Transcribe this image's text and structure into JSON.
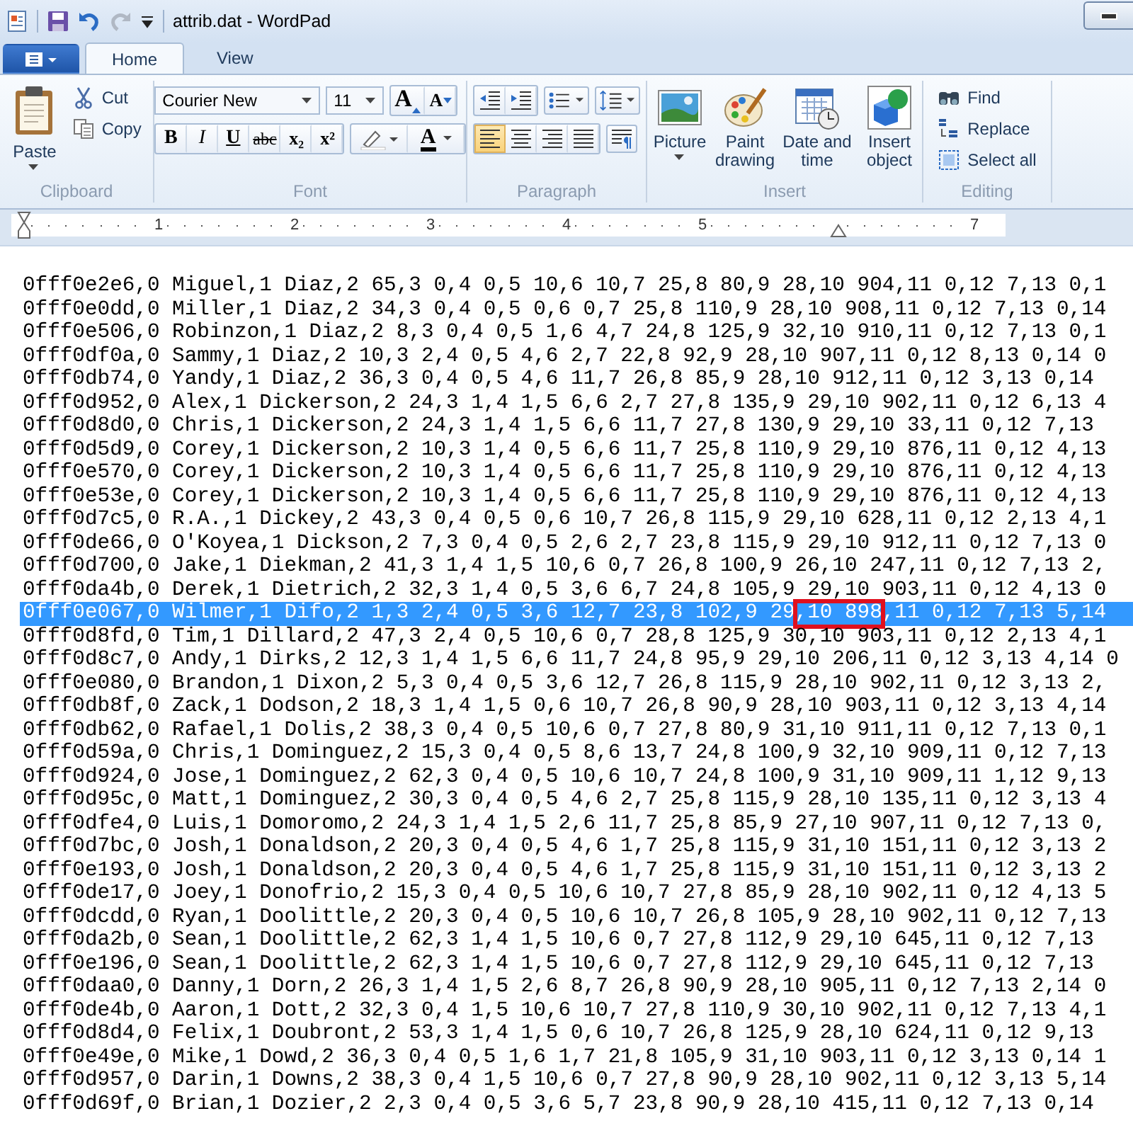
{
  "window": {
    "title": "attrib.dat - WordPad"
  },
  "tabs": [
    {
      "label": "Home",
      "selected": true
    },
    {
      "label": "View",
      "selected": false
    }
  ],
  "ribbon": {
    "clipboard": {
      "label": "Clipboard",
      "paste": "Paste",
      "cut": "Cut",
      "copy": "Copy"
    },
    "font": {
      "label": "Font",
      "family": "Courier New",
      "size": "11",
      "grow": "A",
      "shrink": "A",
      "text_color_label": "A",
      "format_buttons": [
        {
          "kind": "bold",
          "label": "B"
        },
        {
          "kind": "italic",
          "label": "I"
        },
        {
          "kind": "underline",
          "label": "U"
        },
        {
          "kind": "strike",
          "label": "abc"
        },
        {
          "kind": "sub",
          "label": "x₂"
        },
        {
          "kind": "sup",
          "label": "x²"
        }
      ]
    },
    "paragraph": {
      "label": "Paragraph",
      "alignments": [
        {
          "kind": "left",
          "selected": true
        },
        {
          "kind": "center",
          "selected": false
        },
        {
          "kind": "right",
          "selected": false
        },
        {
          "kind": "justify",
          "selected": false
        }
      ]
    },
    "insert": {
      "label": "Insert",
      "items": [
        {
          "kind": "picture",
          "label": "Picture",
          "dropdown": true
        },
        {
          "kind": "paint",
          "label": "Paint drawing",
          "dropdown": false
        },
        {
          "kind": "datetime",
          "label": "Date and time",
          "dropdown": false
        },
        {
          "kind": "object",
          "label": "Insert object",
          "dropdown": false
        }
      ]
    },
    "editing": {
      "label": "Editing",
      "items": [
        {
          "kind": "find",
          "label": "Find"
        },
        {
          "kind": "replace",
          "label": "Replace"
        },
        {
          "kind": "select",
          "label": "Select all"
        }
      ]
    }
  },
  "ruler": {
    "items": [
      {
        "kind": "number",
        "label": "1"
      },
      {
        "kind": "number",
        "label": "2"
      },
      {
        "kind": "number",
        "label": "3"
      },
      {
        "kind": "number",
        "label": "4"
      },
      {
        "kind": "number",
        "label": "5"
      },
      {
        "kind": "indent-marker"
      },
      {
        "kind": "number",
        "label": "7"
      }
    ]
  },
  "document": {
    "lines": [
      {
        "text": "0fff0e2e6,0 Miguel,1 Diaz,2 65,3 0,4 0,5 10,6 10,7 25,8 80,9 28,10 904,11 0,12 7,13 0,1",
        "selected": false,
        "boxed": false
      },
      {
        "text": "0fff0e0dd,0 Miller,1 Diaz,2 34,3 0,4 0,5 0,6 0,7 25,8 110,9 28,10 908,11 0,12 7,13 0,14",
        "selected": false,
        "boxed": false
      },
      {
        "text": "0fff0e506,0 Robinzon,1 Diaz,2 8,3 0,4 0,5 1,6 4,7 24,8 125,9 32,10 910,11 0,12 7,13 0,1",
        "selected": false,
        "boxed": false
      },
      {
        "text": "0fff0df0a,0 Sammy,1 Diaz,2 10,3 2,4 0,5 4,6 2,7 22,8 92,9 28,10 907,11 0,12 8,13 0,14 0",
        "selected": false,
        "boxed": false
      },
      {
        "text": "0fff0db74,0 Yandy,1 Diaz,2 36,3 0,4 0,5 4,6 11,7 26,8 85,9 28,10 912,11 0,12 3,13 0,14",
        "selected": false,
        "boxed": false
      },
      {
        "text": "0fff0d952,0 Alex,1 Dickerson,2 24,3 1,4 1,5 6,6 2,7 27,8 135,9 29,10 902,11 0,12 6,13 4",
        "selected": false,
        "boxed": false
      },
      {
        "text": "0fff0d8d0,0 Chris,1 Dickerson,2 24,3 1,4 1,5 6,6 11,7 27,8 130,9 29,10 33,11 0,12 7,13",
        "selected": false,
        "boxed": false
      },
      {
        "text": "0fff0d5d9,0 Corey,1 Dickerson,2 10,3 1,4 0,5 6,6 11,7 25,8 110,9 29,10 876,11 0,12 4,13",
        "selected": false,
        "boxed": false
      },
      {
        "text": "0fff0e570,0 Corey,1 Dickerson,2 10,3 1,4 0,5 6,6 11,7 25,8 110,9 29,10 876,11 0,12 4,13",
        "selected": false,
        "boxed": false
      },
      {
        "text": "0fff0e53e,0 Corey,1 Dickerson,2 10,3 1,4 0,5 6,6 11,7 25,8 110,9 29,10 876,11 0,12 4,13",
        "selected": false,
        "boxed": false
      },
      {
        "text": "0fff0d7c5,0 R.A.,1 Dickey,2 43,3 0,4 0,5 0,6 10,7 26,8 115,9 29,10 628,11 0,12 2,13 4,1",
        "selected": false,
        "boxed": false
      },
      {
        "text": "0fff0de66,0 O'Koyea,1 Dickson,2 7,3 0,4 0,5 2,6 2,7 23,8 115,9 29,10 912,11 0,12 7,13 0",
        "selected": false,
        "boxed": false
      },
      {
        "text": "0fff0d700,0 Jake,1 Diekman,2 41,3 1,4 1,5 10,6 0,7 26,8 100,9 26,10 247,11 0,12 7,13 2,",
        "selected": false,
        "boxed": false
      },
      {
        "text": "0fff0da4b,0 Derek,1 Dietrich,2 32,3 1,4 0,5 3,6 6,7 24,8 105,9 29,10 903,11 0,12 4,13 0",
        "selected": false,
        "boxed": false
      },
      {
        "text": "0fff0e067,0 Wilmer,1 Difo,2 1,3 2,4 0,5 3,6 12,7 23,8 102,9 29,10 898,11 0,12 7,13 5,14",
        "selected": true,
        "boxed": true
      },
      {
        "text": "0fff0d8fd,0 Tim,1 Dillard,2 47,3 2,4 0,5 10,6 0,7 28,8 125,9 30,10 903,11 0,12 2,13 4,1",
        "selected": false,
        "boxed": false
      },
      {
        "text": "0fff0d8c7,0 Andy,1 Dirks,2 12,3 1,4 1,5 6,6 11,7 24,8 95,9 29,10 206,11 0,12 3,13 4,14 0",
        "selected": false,
        "boxed": false
      },
      {
        "text": "0fff0e080,0 Brandon,1 Dixon,2 5,3 0,4 0,5 3,6 12,7 26,8 115,9 28,10 902,11 0,12 3,13 2,",
        "selected": false,
        "boxed": false
      },
      {
        "text": "0fff0db8f,0 Zack,1 Dodson,2 18,3 1,4 1,5 0,6 10,7 26,8 90,9 28,10 903,11 0,12 3,13 4,14",
        "selected": false,
        "boxed": false
      },
      {
        "text": "0fff0db62,0 Rafael,1 Dolis,2 38,3 0,4 0,5 10,6 0,7 27,8 80,9 31,10 911,11 0,12 7,13 0,1",
        "selected": false,
        "boxed": false
      },
      {
        "text": "0fff0d59a,0 Chris,1 Dominguez,2 15,3 0,4 0,5 8,6 13,7 24,8 100,9 32,10 909,11 0,12 7,13",
        "selected": false,
        "boxed": false
      },
      {
        "text": "0fff0d924,0 Jose,1 Dominguez,2 62,3 0,4 0,5 10,6 10,7 24,8 100,9 31,10 909,11 1,12 9,13",
        "selected": false,
        "boxed": false
      },
      {
        "text": "0fff0d95c,0 Matt,1 Dominguez,2 30,3 0,4 0,5 4,6 2,7 25,8 115,9 28,10 135,11 0,12 3,13 4",
        "selected": false,
        "boxed": false
      },
      {
        "text": "0fff0dfe4,0 Luis,1 Domoromo,2 24,3 1,4 1,5 2,6 11,7 25,8 85,9 27,10 907,11 0,12 7,13 0,",
        "selected": false,
        "boxed": false
      },
      {
        "text": "0fff0d7bc,0 Josh,1 Donaldson,2 20,3 0,4 0,5 4,6 1,7 25,8 115,9 31,10 151,11 0,12 3,13 2",
        "selected": false,
        "boxed": false
      },
      {
        "text": "0fff0e193,0 Josh,1 Donaldson,2 20,3 0,4 0,5 4,6 1,7 25,8 115,9 31,10 151,11 0,12 3,13 2",
        "selected": false,
        "boxed": false
      },
      {
        "text": "0fff0de17,0 Joey,1 Donofrio,2 15,3 0,4 0,5 10,6 10,7 27,8 85,9 28,10 902,11 0,12 4,13 5",
        "selected": false,
        "boxed": false
      },
      {
        "text": "0fff0dcdd,0 Ryan,1 Doolittle,2 20,3 0,4 0,5 10,6 10,7 26,8 105,9 28,10 902,11 0,12 7,13",
        "selected": false,
        "boxed": false
      },
      {
        "text": "0fff0da2b,0 Sean,1 Doolittle,2 62,3 1,4 1,5 10,6 0,7 27,8 112,9 29,10 645,11 0,12 7,13",
        "selected": false,
        "boxed": false
      },
      {
        "text": "0fff0e196,0 Sean,1 Doolittle,2 62,3 1,4 1,5 10,6 0,7 27,8 112,9 29,10 645,11 0,12 7,13",
        "selected": false,
        "boxed": false
      },
      {
        "text": "0fff0daa0,0 Danny,1 Dorn,2 26,3 1,4 1,5 2,6 8,7 26,8 90,9 28,10 905,11 0,12 7,13 2,14 0",
        "selected": false,
        "boxed": false
      },
      {
        "text": "0fff0de4b,0 Aaron,1 Dott,2 32,3 0,4 1,5 10,6 10,7 27,8 110,9 30,10 902,11 0,12 7,13 4,1",
        "selected": false,
        "boxed": false
      },
      {
        "text": "0fff0d8d4,0 Felix,1 Doubront,2 53,3 1,4 1,5 0,6 10,7 26,8 125,9 28,10 624,11 0,12 9,13",
        "selected": false,
        "boxed": false
      },
      {
        "text": "0fff0e49e,0 Mike,1 Dowd,2 36,3 0,4 0,5 1,6 1,7 21,8 105,9 31,10 903,11 0,12 3,13 0,14 1",
        "selected": false,
        "boxed": false
      },
      {
        "text": "0fff0d957,0 Darin,1 Downs,2 38,3 0,4 1,5 10,6 0,7 27,8 90,9 28,10 902,11 0,12 3,13 5,14",
        "selected": false,
        "boxed": false
      },
      {
        "text": "0fff0d69f,0 Brian,1 Dozier,2 2,3 0,4 0,5 3,6 5,7 23,8 90,9 28,10 415,11 0,12 7,13 0,14",
        "selected": false,
        "boxed": false
      }
    ]
  }
}
